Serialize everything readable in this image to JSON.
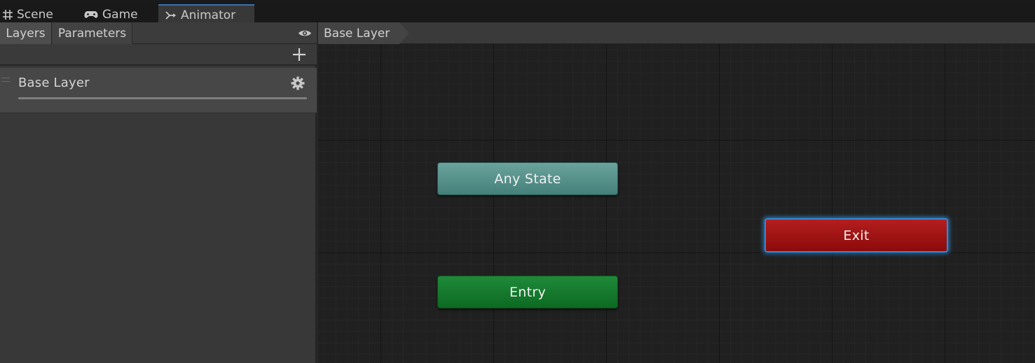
{
  "tabs": [
    {
      "label": "Scene",
      "icon": "grid-icon"
    },
    {
      "label": "Game",
      "icon": "gamepad-icon"
    },
    {
      "label": "Animator",
      "icon": "animator-icon",
      "active": true
    }
  ],
  "left_panel": {
    "subtabs": [
      "Layers",
      "Parameters"
    ],
    "layers": [
      {
        "name": "Base Layer"
      }
    ]
  },
  "graph": {
    "breadcrumb": "Base Layer",
    "nodes": {
      "any_state": "Any State",
      "entry": "Entry",
      "exit": "Exit"
    }
  },
  "colors": {
    "any_state": "#5a948e",
    "entry": "#147a2e",
    "exit": "#a01414",
    "selection_outline": "#2f8ad8",
    "active_tab_accent": "#3a72b0"
  }
}
